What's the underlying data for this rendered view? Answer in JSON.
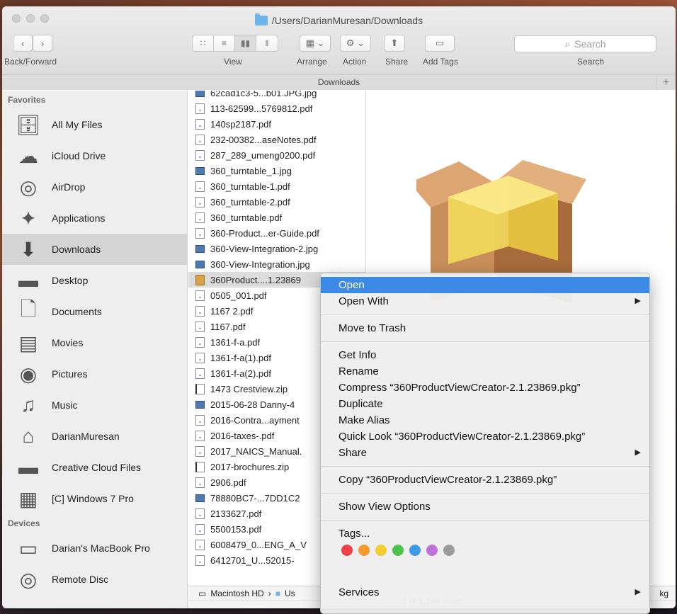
{
  "window": {
    "title": "/Users/DarianMuresan/Downloads"
  },
  "toolbar": {
    "back_forward_label": "Back/Forward",
    "view_label": "View",
    "arrange_label": "Arrange",
    "action_label": "Action",
    "share_label": "Share",
    "add_tags_label": "Add Tags",
    "search_label": "Search",
    "search_placeholder": "Search"
  },
  "path_tab": {
    "label": "Downloads"
  },
  "sidebar": {
    "favorites_header": "Favorites",
    "favorites": [
      {
        "label": "All My Files",
        "icon": "all-files-icon"
      },
      {
        "label": "iCloud Drive",
        "icon": "cloud-icon"
      },
      {
        "label": "AirDrop",
        "icon": "airdrop-icon"
      },
      {
        "label": "Applications",
        "icon": "applications-icon"
      },
      {
        "label": "Downloads",
        "icon": "download-icon",
        "selected": true
      },
      {
        "label": "Desktop",
        "icon": "desktop-icon"
      },
      {
        "label": "Documents",
        "icon": "documents-icon"
      },
      {
        "label": "Movies",
        "icon": "movies-icon"
      },
      {
        "label": "Pictures",
        "icon": "camera-icon"
      },
      {
        "label": "Music",
        "icon": "music-note-icon"
      },
      {
        "label": "DarianMuresan",
        "icon": "home-icon"
      },
      {
        "label": "Creative Cloud Files",
        "icon": "folder-icon"
      },
      {
        "label": "[C] Windows 7 Pro",
        "icon": "network-drive-icon"
      }
    ],
    "devices_header": "Devices",
    "devices": [
      {
        "label": "Darian's MacBook Pro",
        "icon": "laptop-icon"
      },
      {
        "label": "Remote Disc",
        "icon": "disc-icon"
      }
    ]
  },
  "files": [
    {
      "name": "62cad1c3-5...b01.JPG.jpg",
      "type": "img"
    },
    {
      "name": "113-62599...5769812.pdf",
      "type": "pdf"
    },
    {
      "name": "140sp2187.pdf",
      "type": "pdf"
    },
    {
      "name": "232-00382...aseNotes.pdf",
      "type": "pdf"
    },
    {
      "name": "287_289_umeng0200.pdf",
      "type": "pdf"
    },
    {
      "name": "360_turntable_1.jpg",
      "type": "img"
    },
    {
      "name": "360_turntable-1.pdf",
      "type": "pdf"
    },
    {
      "name": "360_turntable-2.pdf",
      "type": "pdf"
    },
    {
      "name": "360_turntable.pdf",
      "type": "pdf"
    },
    {
      "name": "360-Product...er-Guide.pdf",
      "type": "pdf"
    },
    {
      "name": "360-View-Integration-2.jpg",
      "type": "img"
    },
    {
      "name": "360-View-Integration.jpg",
      "type": "img"
    },
    {
      "name": "360Product....1.23869",
      "type": "pkg",
      "selected": true
    },
    {
      "name": "0505_001.pdf",
      "type": "pdf"
    },
    {
      "name": "1167 2.pdf",
      "type": "pdf"
    },
    {
      "name": "1167.pdf",
      "type": "pdf"
    },
    {
      "name": "1361-f-a.pdf",
      "type": "pdf"
    },
    {
      "name": "1361-f-a(1).pdf",
      "type": "pdf"
    },
    {
      "name": "1361-f-a(2).pdf",
      "type": "pdf"
    },
    {
      "name": "1473 Crestview.zip",
      "type": "zip"
    },
    {
      "name": "2015-06-28 Danny-4",
      "type": "img"
    },
    {
      "name": "2016-Contra...ayment",
      "type": "pdf"
    },
    {
      "name": "2016-taxes-.pdf",
      "type": "pdf"
    },
    {
      "name": "2017_NAICS_Manual.",
      "type": "pdf"
    },
    {
      "name": "2017-brochures.zip",
      "type": "zip"
    },
    {
      "name": "2906.pdf",
      "type": "pdf"
    },
    {
      "name": "78880BC7-...7DD1C2",
      "type": "img"
    },
    {
      "name": "2133627.pdf",
      "type": "pdf"
    },
    {
      "name": "5500153.pdf",
      "type": "pdf"
    },
    {
      "name": "6008479_0...ENG_A_V",
      "type": "pdf"
    },
    {
      "name": "6412701_U...52015-",
      "type": "pdf"
    }
  ],
  "pathbar": {
    "drive": "Macintosh HD",
    "next": "Us",
    "right_fragment": "kg"
  },
  "status": {
    "text": "1 of 1,184 selec"
  },
  "context_menu": {
    "items": [
      {
        "label": "Open",
        "highlighted": true
      },
      {
        "label": "Open With",
        "submenu": true
      },
      {
        "sep": true
      },
      {
        "label": "Move to Trash"
      },
      {
        "sep": true
      },
      {
        "label": "Get Info"
      },
      {
        "label": "Rename"
      },
      {
        "label": "Compress “360ProductViewCreator-2.1.23869.pkg”"
      },
      {
        "label": "Duplicate"
      },
      {
        "label": "Make Alias"
      },
      {
        "label": "Quick Look “360ProductViewCreator-2.1.23869.pkg”"
      },
      {
        "label": "Share",
        "submenu": true
      },
      {
        "sep": true
      },
      {
        "label": "Copy “360ProductViewCreator-2.1.23869.pkg”"
      },
      {
        "sep": true
      },
      {
        "label": "Show View Options"
      },
      {
        "sep": true
      },
      {
        "label": "Tags..."
      }
    ],
    "tag_colors": [
      "#f0404a",
      "#f59a2c",
      "#f5cd2e",
      "#4cc34a",
      "#3d9ae8",
      "#c072dc",
      "#9c9c9c"
    ],
    "services_label": "Services",
    "highlight_color": "#3d8ae6"
  }
}
